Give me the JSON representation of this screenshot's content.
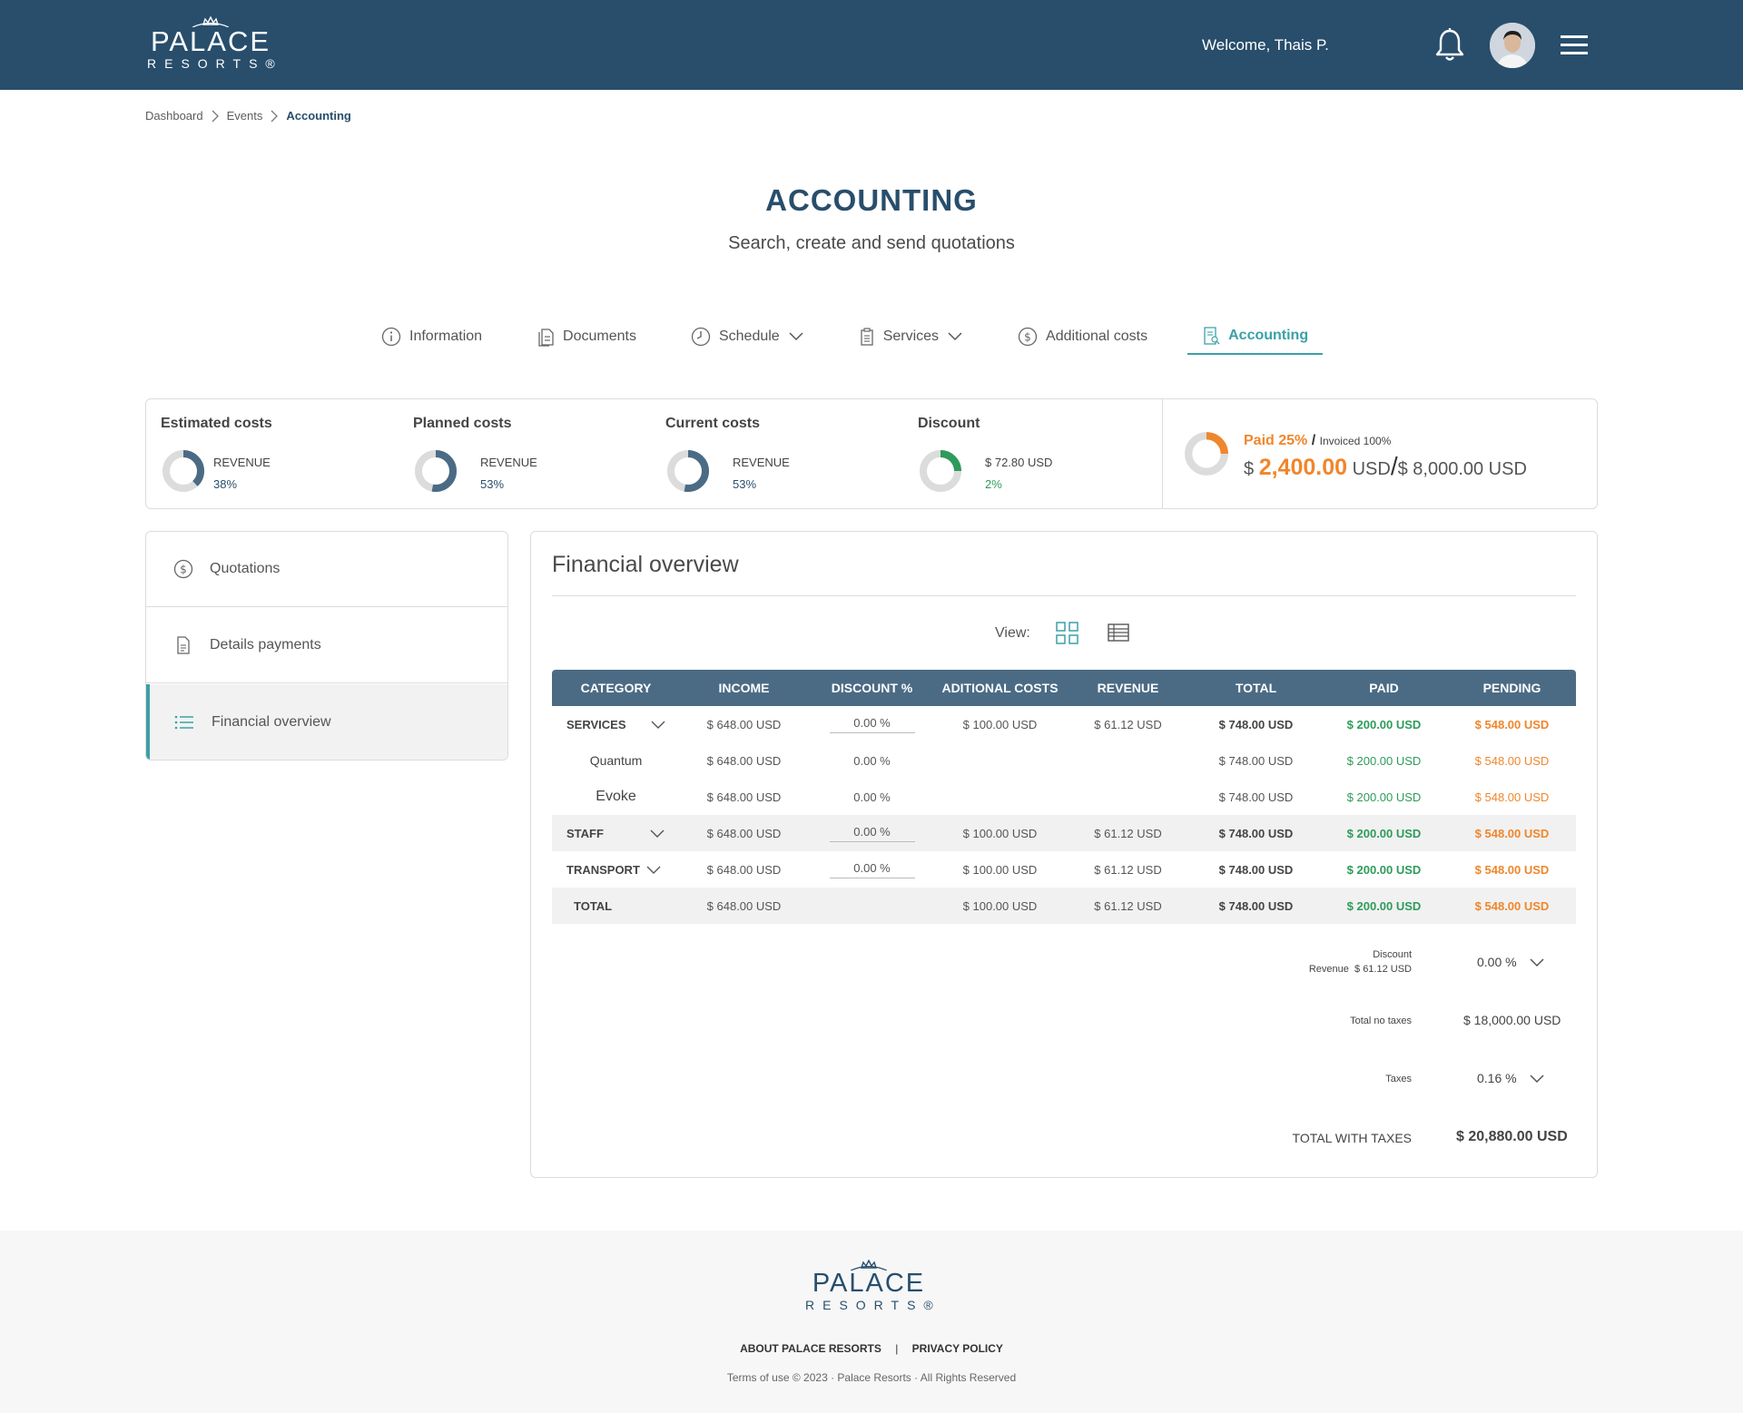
{
  "header": {
    "logo_line1": "PALACE",
    "logo_line2": "RESORTS®",
    "welcome": "Welcome, Thais P."
  },
  "breadcrumb": [
    "Dashboard",
    "Events",
    "Accounting"
  ],
  "page": {
    "title": "ACCOUNTING",
    "subtitle": "Search, create and send quotations"
  },
  "tabs": [
    {
      "label": "Information",
      "icon": "info-icon"
    },
    {
      "label": "Documents",
      "icon": "documents-icon"
    },
    {
      "label": "Schedule",
      "icon": "clock-icon",
      "dropdown": true
    },
    {
      "label": "Services",
      "icon": "clipboard-icon",
      "dropdown": true
    },
    {
      "label": "Additional costs",
      "icon": "dollar-circle-icon"
    },
    {
      "label": "Accounting",
      "icon": "receipt-icon",
      "active": true
    }
  ],
  "summary": {
    "estimated": {
      "title": "Estimated costs",
      "label": "REVENUE",
      "pct": "38%",
      "fraction": 0.38
    },
    "planned": {
      "title": "Planned costs",
      "label": "REVENUE",
      "pct": "53%",
      "fraction": 0.53
    },
    "current": {
      "title": "Current costs",
      "label": "REVENUE",
      "pct": "53%",
      "fraction": 0.53
    },
    "discount": {
      "title": "Discount",
      "label": "$ 72.80 USD",
      "pct": "2%",
      "fraction": 0.02
    },
    "paid": {
      "paid_label": "Paid 25%",
      "slash": "/",
      "invoiced_label": "Invoiced 100%",
      "currency": "$",
      "amount": "2,400.00",
      "amount_unit": "USD",
      "total": "$ 8,000.00 USD",
      "fraction": 0.25
    }
  },
  "side_menu": [
    {
      "label": "Quotations",
      "icon": "dollar-circle-icon"
    },
    {
      "label": "Details payments",
      "icon": "document-icon"
    },
    {
      "label": "Financial overview",
      "icon": "list-icon",
      "active": true
    }
  ],
  "panel": {
    "title": "Financial overview",
    "view_label": "View:"
  },
  "table": {
    "columns": [
      "CATEGORY",
      "INCOME",
      "DISCOUNT %",
      "ADITIONAL COSTS",
      "REVENUE",
      "TOTAL",
      "PAID",
      "PENDING"
    ],
    "rows": [
      {
        "category": "SERVICES",
        "income": "$ 648.00 USD",
        "discount": "0.00 %",
        "additional": "$ 100.00 USD",
        "revenue": "$ 61.12 USD",
        "total": "$ 748.00 USD",
        "paid": "$ 200.00 USD",
        "pending": "$ 548.00 USD"
      },
      {
        "category": "Quantum",
        "income": "$ 648.00 USD",
        "discount": "0.00 %",
        "additional": "",
        "revenue": "",
        "total": "$ 748.00 USD",
        "paid": "$ 200.00 USD",
        "pending": "$ 548.00 USD"
      },
      {
        "category": "Evoke",
        "income": "$ 648.00 USD",
        "discount": "0.00 %",
        "additional": "",
        "revenue": "",
        "total": "$ 748.00 USD",
        "paid": "$ 200.00 USD",
        "pending": "$ 548.00 USD"
      },
      {
        "category": "STAFF",
        "income": "$ 648.00 USD",
        "discount": "0.00 %",
        "additional": "$ 100.00 USD",
        "revenue": "$ 61.12 USD",
        "total": "$ 748.00 USD",
        "paid": "$ 200.00 USD",
        "pending": "$ 548.00 USD"
      },
      {
        "category": "TRANSPORT",
        "income": "$ 648.00 USD",
        "discount": "0.00 %",
        "additional": "$ 100.00 USD",
        "revenue": "$ 61.12 USD",
        "total": "$ 748.00 USD",
        "paid": "$ 200.00 USD",
        "pending": "$ 548.00 USD"
      },
      {
        "category": "TOTAL",
        "income": "$ 648.00 USD",
        "discount": "",
        "additional": "$ 100.00 USD",
        "revenue": "$ 61.12 USD",
        "total": "$ 748.00 USD",
        "paid": "$ 200.00 USD",
        "pending": "$ 548.00 USD"
      }
    ]
  },
  "totals": {
    "discount_label": "Discount",
    "revenue_label": "Revenue",
    "revenue_value": "$ 61.12 USD",
    "discount_value": "0.00 %",
    "no_taxes_label": "Total no taxes",
    "no_taxes_value": "$ 18,000.00 USD",
    "taxes_label": "Taxes",
    "taxes_value": "0.16 %",
    "with_taxes_label": "TOTAL WITH TAXES",
    "with_taxes_value": "$ 20,880.00 USD"
  },
  "footer": {
    "logo_line1": "PALACE",
    "logo_line2": "RESORTS®",
    "link_about": "ABOUT PALACE RESORTS",
    "separator": "|",
    "link_privacy": "PRIVACY POLICY",
    "copyright": "Terms of use © 2023 · Palace Resorts · All Rights Reserved"
  },
  "colors": {
    "header_bg": "#284e6c",
    "accent_teal": "#3aa1a7",
    "table_header": "#4b6b85",
    "paid_green": "#2e9b5b",
    "pending_orange": "#f0862b",
    "donut_blue": "#4b6b85",
    "donut_track": "#dcdcdc"
  }
}
